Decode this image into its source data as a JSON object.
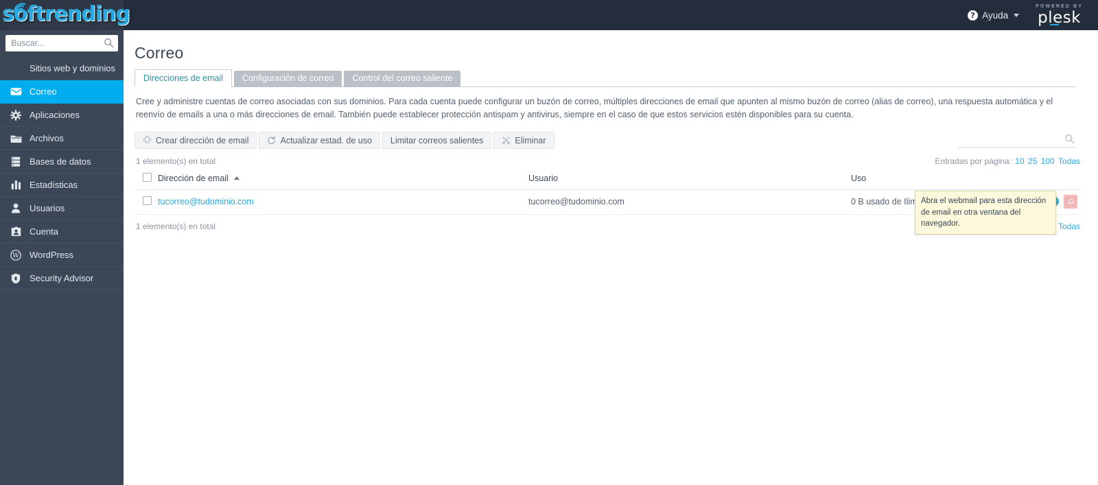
{
  "brand": {
    "logo_text": "softrending",
    "logo_icon": "wifi-signal-icon",
    "plesk_powered_by": "POWERED BY",
    "plesk_name": "plesk"
  },
  "topbar": {
    "help_label": "Ayuda",
    "help_icon": "question-circle-icon",
    "caret_icon": "chevron-down-icon",
    "help_square_label": "?"
  },
  "sidebar": {
    "search_placeholder": "Buscar...",
    "search_value": "",
    "search_icon": "search-icon",
    "items": [
      {
        "label": "Sitios web y dominios",
        "icon": "globe-icon",
        "active": false
      },
      {
        "label": "Correo",
        "icon": "envelope-icon",
        "active": true
      },
      {
        "label": "Aplicaciones",
        "icon": "gear-icon",
        "active": false
      },
      {
        "label": "Archivos",
        "icon": "folder-icon",
        "active": false
      },
      {
        "label": "Bases de datos",
        "icon": "database-icon",
        "active": false
      },
      {
        "label": "Estadísticas",
        "icon": "bar-chart-icon",
        "active": false
      },
      {
        "label": "Usuarios",
        "icon": "user-icon",
        "active": false
      },
      {
        "label": "Cuenta",
        "icon": "id-card-icon",
        "active": false
      },
      {
        "label": "WordPress",
        "icon": "wordpress-icon",
        "active": false
      },
      {
        "label": "Security Advisor",
        "icon": "shield-icon",
        "active": false
      }
    ]
  },
  "page": {
    "title": "Correo",
    "tabs": [
      {
        "label": "Direcciones de email",
        "active": true
      },
      {
        "label": "Configuración de correo",
        "active": false
      },
      {
        "label": "Control del correo saliente",
        "active": false
      }
    ],
    "description": "Cree y administre cuentas de correo asociadas con sus dominios. Para cada cuenta puede configurar un buzón de correo, múltiples direcciones de email que apunten al mismo buzón de correo (alias de correo), una respuesta automática y el reenvío de emails a una o más direcciones de email. También puede establecer protección antispam y antivirus, siempre en el caso de que estos servicios estén disponibles para su cuenta."
  },
  "toolbar": {
    "buttons": [
      {
        "label": "Crear dirección de email",
        "icon": "plus-icon",
        "has_icon": true
      },
      {
        "label": "Actualizar estad. de uso",
        "icon": "refresh-icon",
        "has_icon": true
      },
      {
        "label": "Limitar correos salientes",
        "icon": "",
        "has_icon": false
      },
      {
        "label": "Eliminar",
        "icon": "remove-icon",
        "has_icon": true
      }
    ],
    "search_placeholder": "",
    "search_value": "",
    "search_icon": "search-icon"
  },
  "list": {
    "total_top": "1 elemento(s) en total",
    "total_bottom": "1 elemento(s) en total",
    "pager_label": "Entradas por página:",
    "pager_options": [
      "10",
      "25",
      "100",
      "Todas"
    ],
    "columns": {
      "address": "Dirección de email",
      "user": "Usuario",
      "usage": "Uso"
    },
    "sort_icon": "sort-asc-icon",
    "rows": [
      {
        "address": "tucorreo@tudominio.com",
        "user": "tucorreo@tudominio.com",
        "usage": "0 B usado de Ilimitado",
        "info_icon": "info-icon",
        "webmail_icon": "webmail-icon"
      }
    ]
  },
  "tooltip": {
    "text": "Abra el webmail para esta dirección de email en otra ventana del navegador."
  },
  "colors": {
    "accent": "#00aef0",
    "link": "#2aa9e0",
    "sidebar_bg": "#3b4757",
    "topbar_bg": "#242d3c",
    "tab_active_text": "#2b8fa8",
    "tooltip_bg": "#fbf8dc"
  }
}
